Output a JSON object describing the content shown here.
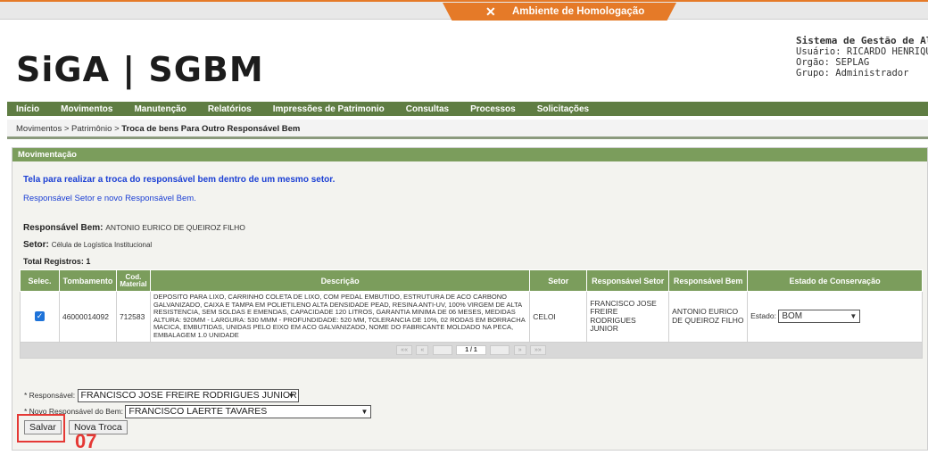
{
  "env": {
    "label": "Ambiente de Homologação"
  },
  "header": {
    "logo": "SiGA | SGBM",
    "system_title": "Sistema de Gestão de Almo",
    "usuario": "Usuário: RICARDO HENRIQUE",
    "orgao": "Orgão: SEPLAG",
    "grupo": "Grupo: Administrador"
  },
  "menu": [
    "Início",
    "Movimentos",
    "Manutenção",
    "Relatórios",
    "Impressões de Patrimonio",
    "Consultas",
    "Processos",
    "Solicitações"
  ],
  "breadcrumb": {
    "path": "Movimentos  > Patrimônio  > ",
    "current": "Troca de bens Para Outro Responsável Bem"
  },
  "panel": {
    "title": "Movimentação",
    "instruction": "Tela para realizar a troca do responsável bem dentro de um mesmo setor.",
    "hint": "Responsável Setor e novo Responsável Bem.",
    "resp_bem_label": "Responsável Bem:",
    "resp_bem_value": "ANTONIO EURICO DE QUEIROZ FILHO",
    "setor_label": "Setor:",
    "setor_value": "Célula de Logística Institucional",
    "total_label": "Total Registros: 1"
  },
  "table": {
    "headers": [
      "Selec.",
      "Tombamento",
      "Cod. Material",
      "Descrição",
      "Setor",
      "Responsável Setor",
      "Responsável Bem",
      "Estado de Conservação"
    ],
    "row": {
      "tombamento": "46000014092",
      "cod_material": "712583",
      "descricao": "DEPOSITO PARA LIXO, CARRINHO COLETA DE LIXO, COM PEDAL EMBUTIDO, ESTRUTURA DE ACO CARBONO GALVANIZADO, CAIXA E TAMPA EM POLIETILENO ALTA DENSIDADE PEAD, RESINA ANTI-UV, 100% VIRGEM DE ALTA RESISTENCIA, SEM SOLDAS E EMENDAS, CAPACIDADE 120 LITROS, GARANTIA MINIMA DE 06 MESES, MEDIDAS ALTURA: 920MM - LARGURA: 530 MMM - PROFUNDIDADE: 520 MM, TOLERANCIA DE 10%, 02 RODAS EM BORRACHA MACICA, EMBUTIDAS, UNIDAS PELO EIXO EM ACO GALVANIZADO, NOME DO FABRICANTE MOLDADO NA PECA, EMBALAGEM 1.0 UNIDADE",
      "setor": "CELOI",
      "resp_setor": "FRANCISCO JOSE FREIRE RODRIGUES JUNIOR",
      "resp_bem": "ANTONIO EURICO DE QUEIROZ FILHO",
      "estado_label": "Estado:",
      "estado_value": "BOM"
    },
    "pager": {
      "first": "«« ",
      "prev": "« ",
      "current": "1 / 1",
      "next": " »",
      "last": " »»"
    }
  },
  "form": {
    "responsavel_label": "* Responsável:",
    "responsavel_value": "FRANCISCO JOSE FREIRE RODRIGUES JUNIOR",
    "novo_label": "* Novo Responsável do Bem:",
    "novo_value": "FRANCISCO LAERTE TAVARES"
  },
  "buttons": {
    "salvar": "Salvar",
    "nova_troca": "Nova Troca"
  },
  "annotation": {
    "step": "07",
    "color": "#e53935"
  },
  "colors": {
    "menu": "#5f7d43",
    "header_green": "#7b9d5c",
    "orange": "#e57a28",
    "link_blue": "#1b3fd4"
  }
}
